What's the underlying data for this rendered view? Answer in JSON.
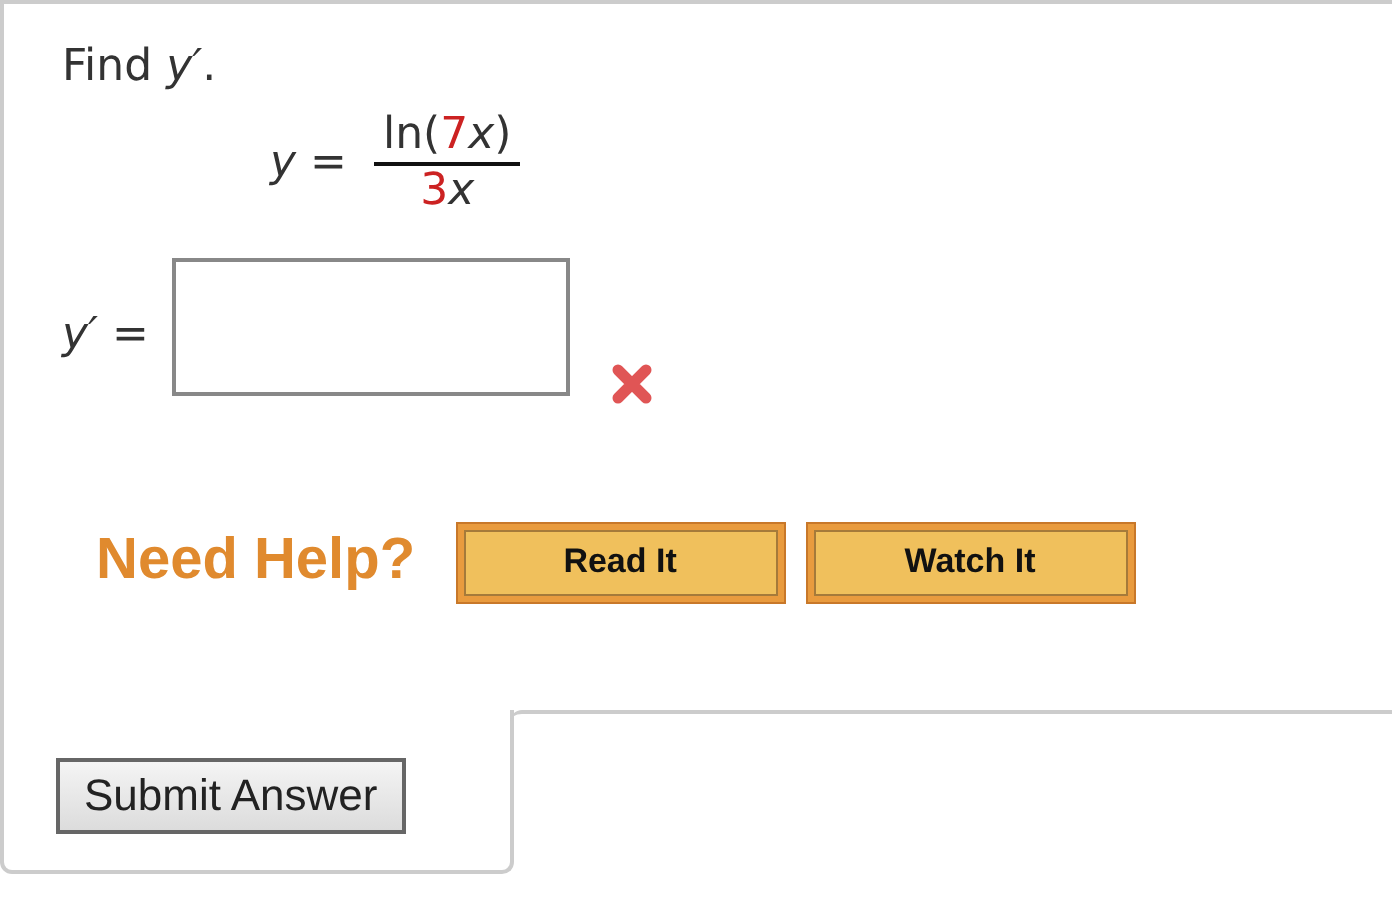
{
  "prompt": "Find *y′*.",
  "equation": {
    "lhs": "y =",
    "numerator": [
      {
        "text": "ln(",
        "kind": "plain"
      },
      {
        "text": "7",
        "kind": "given"
      },
      {
        "text": "x",
        "kind": "variable"
      },
      {
        "text": ")",
        "kind": "plain"
      }
    ],
    "denominator": [
      {
        "text": "3",
        "kind": "given"
      },
      {
        "text": "x",
        "kind": "variable"
      }
    ]
  },
  "answer": {
    "label": "y′ =",
    "correct": false
  },
  "help": {
    "label": "Need Help?",
    "buttons": [
      "Read It",
      "Watch It"
    ]
  },
  "submit": "Submit Answer"
}
